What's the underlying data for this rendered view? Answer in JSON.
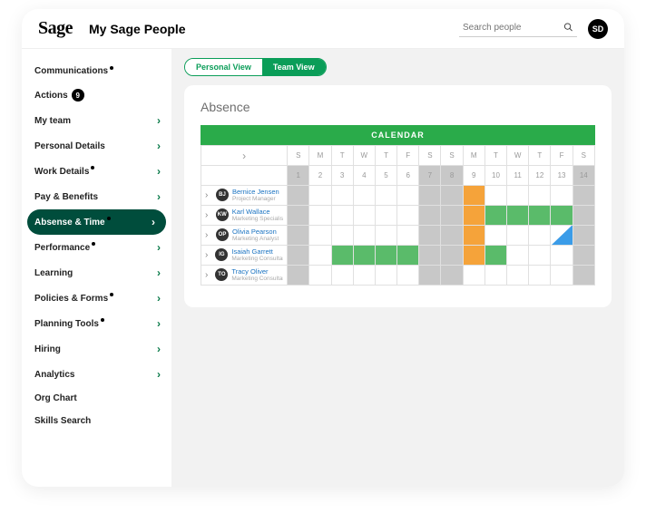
{
  "header": {
    "logo": "Sage",
    "title": "My Sage People",
    "search_placeholder": "Search people",
    "avatar_initials": "SD"
  },
  "sidebar": {
    "items": [
      {
        "label": "Communications",
        "dot": true,
        "chev": false,
        "active": false
      },
      {
        "label": "Actions",
        "badge": "9",
        "chev": false,
        "active": false
      },
      {
        "label": "My team",
        "chev": true,
        "active": false
      },
      {
        "label": "Personal Details",
        "chev": true,
        "active": false
      },
      {
        "label": "Work Details",
        "dot": true,
        "chev": true,
        "active": false
      },
      {
        "label": "Pay & Benefits",
        "chev": true,
        "active": false
      },
      {
        "label": "Absense & Time",
        "dot": true,
        "chev": true,
        "active": true
      },
      {
        "label": "Performance",
        "dot": true,
        "chev": true,
        "active": false
      },
      {
        "label": "Learning",
        "chev": true,
        "active": false
      },
      {
        "label": "Policies & Forms",
        "dot": true,
        "chev": true,
        "active": false
      },
      {
        "label": "Planning Tools",
        "dot": true,
        "chev": true,
        "active": false
      },
      {
        "label": "Hiring",
        "chev": true,
        "active": false
      },
      {
        "label": "Analytics",
        "chev": true,
        "active": false
      },
      {
        "label": "Org Chart",
        "chev": false,
        "active": false
      },
      {
        "label": "Skills Search",
        "chev": false,
        "active": false
      }
    ]
  },
  "tabs": {
    "personal": "Personal View",
    "team": "Team View",
    "active": "team"
  },
  "card": {
    "title": "Absence"
  },
  "calendar": {
    "header": "CALENDAR",
    "dow": [
      "S",
      "M",
      "T",
      "W",
      "T",
      "F",
      "S",
      "S",
      "M",
      "T",
      "W",
      "T",
      "F",
      "S"
    ],
    "nums": [
      "1",
      "2",
      "3",
      "4",
      "5",
      "6",
      "7",
      "8",
      "9",
      "10",
      "11",
      "12",
      "13",
      "14"
    ],
    "weekends": [
      0,
      6,
      7,
      13
    ],
    "people": [
      {
        "init": "BJ",
        "name": "Bernice Jensen",
        "role": "Project Manager",
        "cells": {
          "8": "or"
        }
      },
      {
        "init": "KW",
        "name": "Karl Wallace",
        "role": "Marketing Specialist",
        "cells": {
          "8": "or",
          "9": "gr",
          "10": "gr",
          "11": "gr",
          "12": "gr"
        }
      },
      {
        "init": "OP",
        "name": "Olivia Pearson",
        "role": "Marketing Analyst",
        "cells": {
          "8": "or",
          "12": "bl"
        }
      },
      {
        "init": "IG",
        "name": "Isaiah Garrett",
        "role": "Marketing Consultant",
        "cells": {
          "2": "gr",
          "3": "gr",
          "4": "gr",
          "5": "gr",
          "8": "or",
          "9": "gr"
        }
      },
      {
        "init": "TO",
        "name": "Tracy Oliver",
        "role": "Marketing Consultant",
        "cells": {}
      }
    ]
  }
}
